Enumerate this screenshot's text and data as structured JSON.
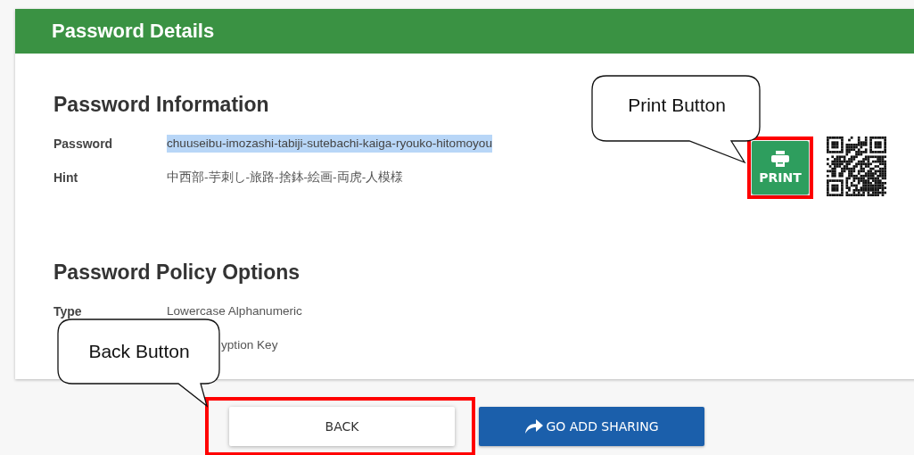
{
  "header": {
    "title": "Password Details"
  },
  "password_information": {
    "title": "Password Information",
    "fields": [
      {
        "label": "Password",
        "value": "chuuseibu-imozashi-tabiji-sutebachi-kaiga-ryouko-hitomoyou",
        "selected": true
      },
      {
        "label": "Hint",
        "value": "中西部-芋刺し-旅路-捨鉢-絵画-両虎-人模様",
        "selected": false
      }
    ],
    "print_button": {
      "label": "PRINT",
      "highlighted": true
    }
  },
  "password_policy_options": {
    "title": "Password Policy Options",
    "fields": [
      {
        "label": "Type",
        "value": "Lowercase Alphanumeric"
      },
      {
        "value": "yption Key"
      }
    ]
  },
  "buttons": [
    {
      "label": "BACK",
      "kind": "default",
      "highlighted": true
    },
    {
      "label": "GO ADD SHARING",
      "kind": "primary",
      "highlighted": false
    }
  ],
  "callouts": [
    {
      "text": "Print Button"
    },
    {
      "text": "Back Button"
    }
  ]
}
